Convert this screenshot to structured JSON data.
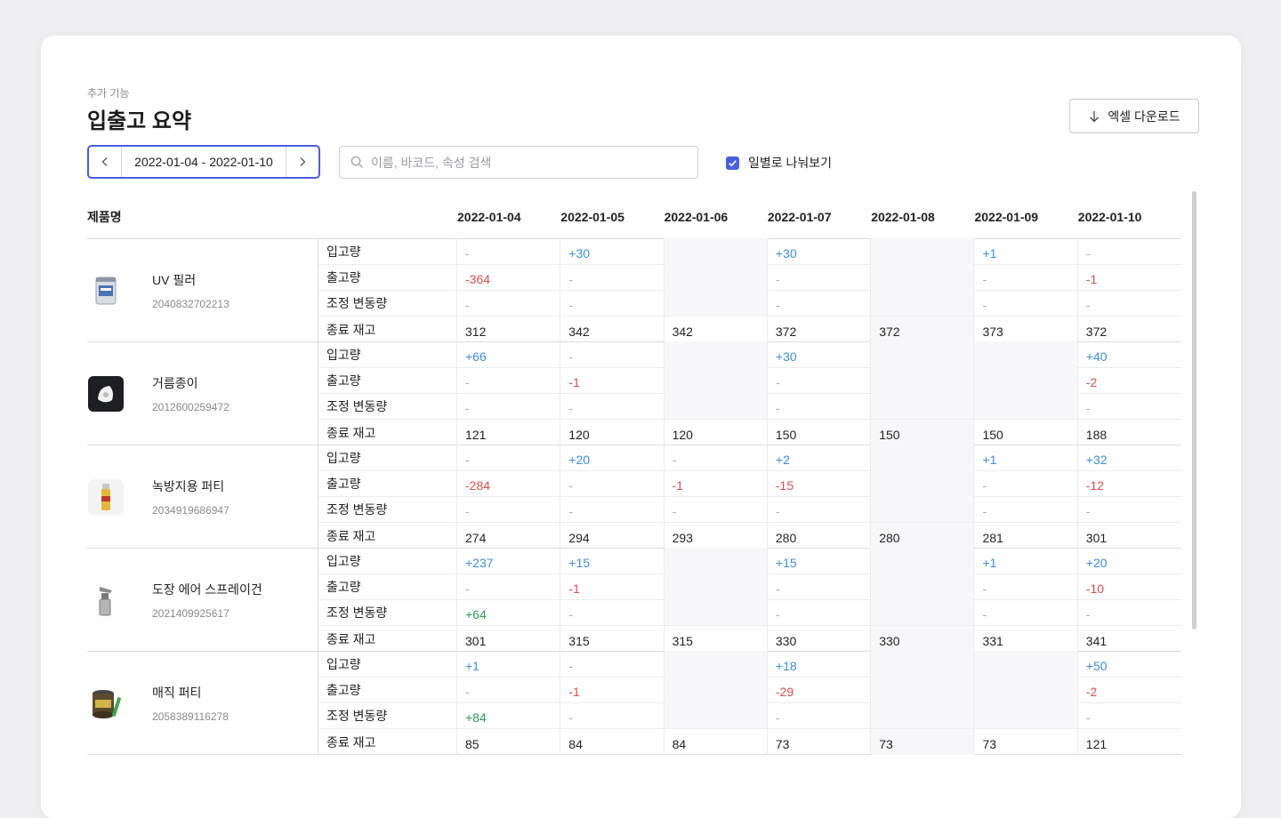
{
  "header": {
    "subtitle": "추가 기능",
    "title": "입출고 요약",
    "excel_label": "엑셀 다운로드"
  },
  "filters": {
    "date_range": "2022-01-04 - 2022-01-10",
    "search_placeholder": "이름, 바코드, 속성 검색",
    "daily_label": "일별로 나눠보기",
    "daily_checked": true
  },
  "table": {
    "name_header": "제품명",
    "dates": [
      "2022-01-04",
      "2022-01-05",
      "2022-01-06",
      "2022-01-07",
      "2022-01-08",
      "2022-01-09",
      "2022-01-10"
    ],
    "metric_labels": [
      "입고량",
      "출고량",
      "조정 변동량",
      "종료 재고"
    ],
    "products": [
      {
        "name": "UV 필러",
        "code": "2040832702213",
        "icon": "can-icon",
        "rows": [
          [
            "-",
            "+30",
            "",
            "+30",
            "",
            "+1",
            "-"
          ],
          [
            "-364",
            "-",
            "",
            "-",
            "",
            "-",
            "-1"
          ],
          [
            "-",
            "-",
            "",
            "-",
            "",
            "-",
            "-"
          ],
          [
            "312",
            "342",
            "342",
            "372",
            "372",
            "373",
            "372"
          ]
        ]
      },
      {
        "name": "거름종이",
        "code": "2012600259472",
        "icon": "filter-paper-icon",
        "rows": [
          [
            "+66",
            "-",
            "",
            "+30",
            "",
            "",
            "+40"
          ],
          [
            "-",
            "-1",
            "",
            "-",
            "",
            "",
            "-2"
          ],
          [
            "-",
            "-",
            "",
            "-",
            "",
            "",
            "-"
          ],
          [
            "121",
            "120",
            "120",
            "150",
            "150",
            "150",
            "188"
          ]
        ]
      },
      {
        "name": "녹방지용 퍼티",
        "code": "2034919686947",
        "icon": "spray-can-icon",
        "rows": [
          [
            "-",
            "+20",
            "-",
            "+2",
            "",
            "+1",
            "+32"
          ],
          [
            "-284",
            "-",
            "-1",
            "-15",
            "",
            "-",
            "-12"
          ],
          [
            "-",
            "-",
            "-",
            "-",
            "",
            "-",
            "-"
          ],
          [
            "274",
            "294",
            "293",
            "280",
            "280",
            "281",
            "301"
          ]
        ]
      },
      {
        "name": "도장 에어 스프레이건",
        "code": "2021409925617",
        "icon": "spray-gun-icon",
        "rows": [
          [
            "+237",
            "+15",
            "",
            "+15",
            "",
            "+1",
            "+20"
          ],
          [
            "-",
            "-1",
            "",
            "-",
            "",
            "-",
            "-10"
          ],
          [
            "+64",
            "-",
            "",
            "-",
            "",
            "-",
            "-"
          ],
          [
            "301",
            "315",
            "315",
            "330",
            "330",
            "331",
            "341"
          ]
        ]
      },
      {
        "name": "매직 퍼티",
        "code": "2058389116278",
        "icon": "putty-can-icon",
        "rows": [
          [
            "+1",
            "-",
            "",
            "+18",
            "",
            "",
            "+50"
          ],
          [
            "-",
            "-1",
            "",
            "-29",
            "",
            "",
            "-2"
          ],
          [
            "+84",
            "-",
            "",
            "-",
            "",
            "",
            "-"
          ],
          [
            "85",
            "84",
            "84",
            "73",
            "73",
            "73",
            "121"
          ]
        ]
      }
    ]
  },
  "colors": {
    "accent": "#4a5fe0",
    "positive": "#3f8de0",
    "negative": "#e34b4b",
    "adjustment": "#2e9e57"
  }
}
